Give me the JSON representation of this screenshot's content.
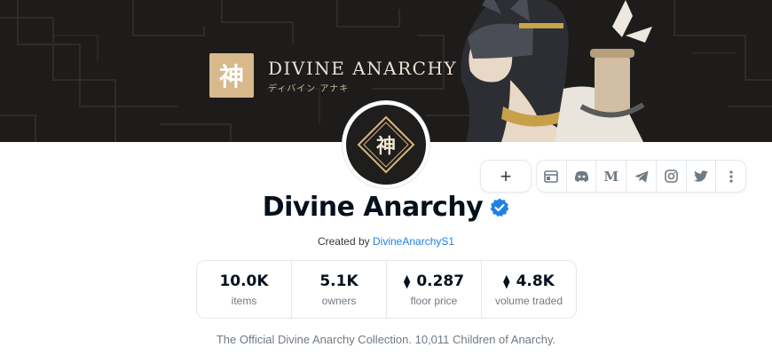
{
  "banner": {
    "brand_title": "DIVINE ANARCHY",
    "brand_subtitle": "ディバイン アナキ",
    "logo_char": "神",
    "colors": {
      "background": "#1d1c1b",
      "gold": "#d8b98c"
    }
  },
  "avatar": {
    "char": "神"
  },
  "actions": {
    "add_label": "+",
    "social_icons": [
      "website-icon",
      "discord-icon",
      "medium-icon",
      "telegram-icon",
      "instagram-icon",
      "twitter-icon",
      "more-icon"
    ],
    "medium_letter": "M"
  },
  "collection": {
    "name": "Divine Anarchy",
    "verified": true,
    "created_prefix": "Created by ",
    "creator": "DivineAnarchyS1",
    "description": "The Official Divine Anarchy Collection. 10,011 Children of Anarchy."
  },
  "stats": [
    {
      "value": "10.0K",
      "label": "items",
      "eth": false
    },
    {
      "value": "5.1K",
      "label": "owners",
      "eth": false
    },
    {
      "value": "0.287",
      "label": "floor price",
      "eth": true
    },
    {
      "value": "4.8K",
      "label": "volume traded",
      "eth": true
    }
  ],
  "eth_symbol": "⧫",
  "colors": {
    "link": "#2081e2",
    "verified": "#2081e2",
    "border": "#e5e8eb",
    "muted": "#707a83"
  }
}
